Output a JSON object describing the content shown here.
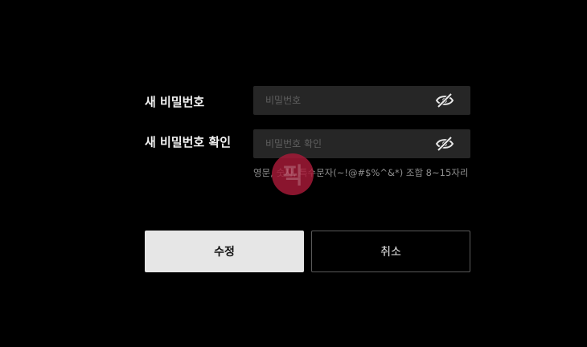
{
  "form": {
    "new_password": {
      "label": "새 비밀번호",
      "placeholder": "비밀번호",
      "value": "",
      "toggle_icon": "eye-slash-icon"
    },
    "confirm_password": {
      "label": "새 비밀번호 확인",
      "placeholder": "비밀번호 확인",
      "value": "",
      "toggle_icon": "eye-slash-icon"
    },
    "hint": "영문, 숫자, 특수문자(~!@#$%^&*) 조합 8~15자리"
  },
  "actions": {
    "submit_label": "수정",
    "cancel_label": "취소"
  },
  "watermark": {
    "text": "픽",
    "color": "#a81a38"
  },
  "colors": {
    "background": "#000000",
    "input_background": "#262626",
    "submit_background": "#e6e6e6",
    "cancel_border": "#5a5a5a"
  }
}
